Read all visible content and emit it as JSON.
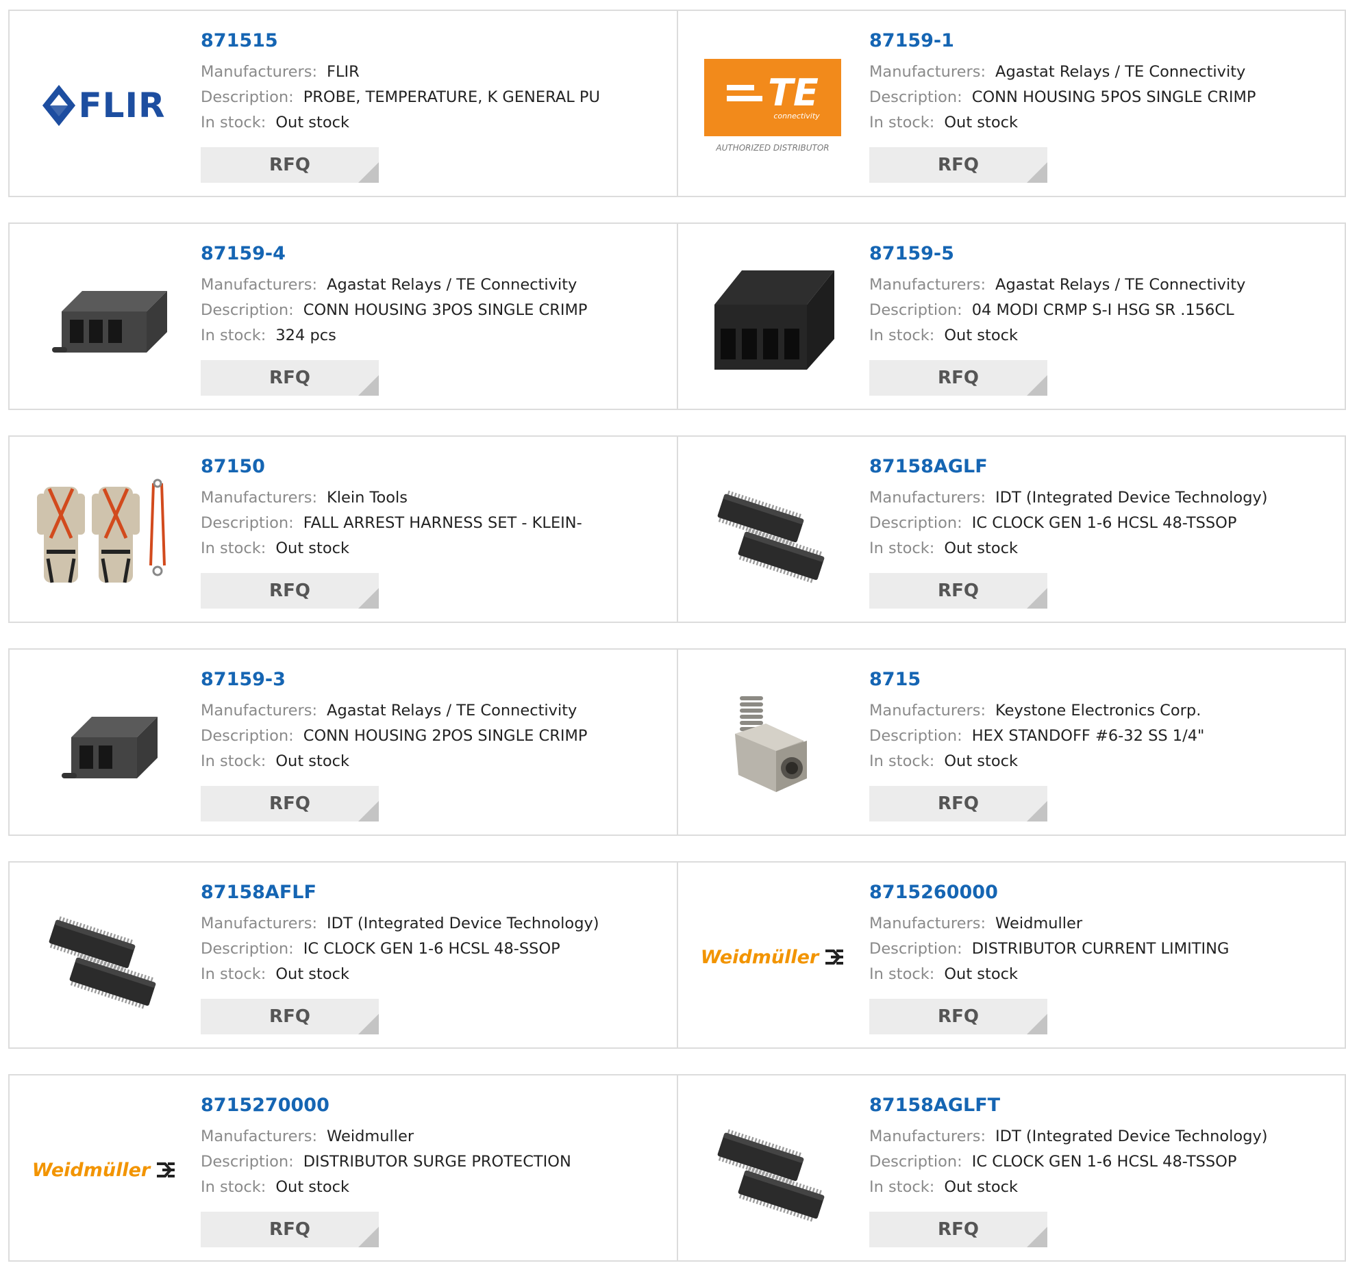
{
  "labels": {
    "manufacturers": "Manufacturers:",
    "description": "Description:",
    "in_stock": "In stock:",
    "rfq": "RFQ"
  },
  "colors": {
    "part_link": "#1565b3",
    "card_border": "#dcdcdc",
    "rfq_bg": "#ececec",
    "flir_blue": "#1d4ea0",
    "te_orange": "#f28a1b",
    "weidmuller_orange": "#f29400"
  },
  "products": [
    {
      "part": "871515",
      "manufacturer": "FLIR",
      "description": "PROBE, TEMPERATURE, K GENERAL PU",
      "stock": "Out stock",
      "image": "flir-logo",
      "logo": {
        "text": "FLIR"
      }
    },
    {
      "part": "87159-1",
      "manufacturer": "Agastat Relays / TE Connectivity",
      "description": "CONN HOUSING 5POS SINGLE CRIMP",
      "stock": "Out stock",
      "image": "te-logo",
      "logo": {
        "text": "TE",
        "sub": "connectivity",
        "caption": "AUTHORIZED DISTRIBUTOR"
      }
    },
    {
      "part": "87159-4",
      "manufacturer": "Agastat Relays / TE Connectivity",
      "description": "CONN HOUSING 3POS SINGLE CRIMP",
      "stock": "324 pcs",
      "image": "connector-housing-3pos"
    },
    {
      "part": "87159-5",
      "manufacturer": "Agastat Relays / TE Connectivity",
      "description": "04 MODI CRMP S-I HSG SR .156CL",
      "stock": "Out stock",
      "image": "connector-housing-4pos"
    },
    {
      "part": "87150",
      "manufacturer": "Klein Tools",
      "description": "FALL ARREST HARNESS SET - KLEIN-",
      "stock": "Out stock",
      "image": "harness-photo"
    },
    {
      "part": "87158AGLF",
      "manufacturer": "IDT (Integrated Device Technology)",
      "description": "IC CLOCK GEN 1-6 HCSL 48-TSSOP",
      "stock": "Out stock",
      "image": "ic-chips"
    },
    {
      "part": "87159-3",
      "manufacturer": "Agastat Relays / TE Connectivity",
      "description": "CONN HOUSING 2POS SINGLE CRIMP",
      "stock": "Out stock",
      "image": "connector-housing-2pos"
    },
    {
      "part": "8715",
      "manufacturer": "Keystone Electronics Corp.",
      "description": "HEX STANDOFF #6-32 SS 1/4\"",
      "stock": "Out stock",
      "image": "hex-standoff"
    },
    {
      "part": "87158AFLF",
      "manufacturer": "IDT (Integrated Device Technology)",
      "description": "IC CLOCK GEN 1-6 HCSL 48-SSOP",
      "stock": "Out stock",
      "image": "ic-chips"
    },
    {
      "part": "8715260000",
      "manufacturer": "Weidmuller",
      "description": "DISTRIBUTOR CURRENT LIMITING",
      "stock": "Out stock",
      "image": "weidmuller-logo",
      "logo": {
        "text": "Weidmüller"
      }
    },
    {
      "part": "8715270000",
      "manufacturer": "Weidmuller",
      "description": "DISTRIBUTOR SURGE PROTECTION",
      "stock": "Out stock",
      "image": "weidmuller-logo",
      "logo": {
        "text": "Weidmüller"
      }
    },
    {
      "part": "87158AGLFT",
      "manufacturer": "IDT (Integrated Device Technology)",
      "description": "IC CLOCK GEN 1-6 HCSL 48-TSSOP",
      "stock": "Out stock",
      "image": "ic-chips"
    }
  ]
}
